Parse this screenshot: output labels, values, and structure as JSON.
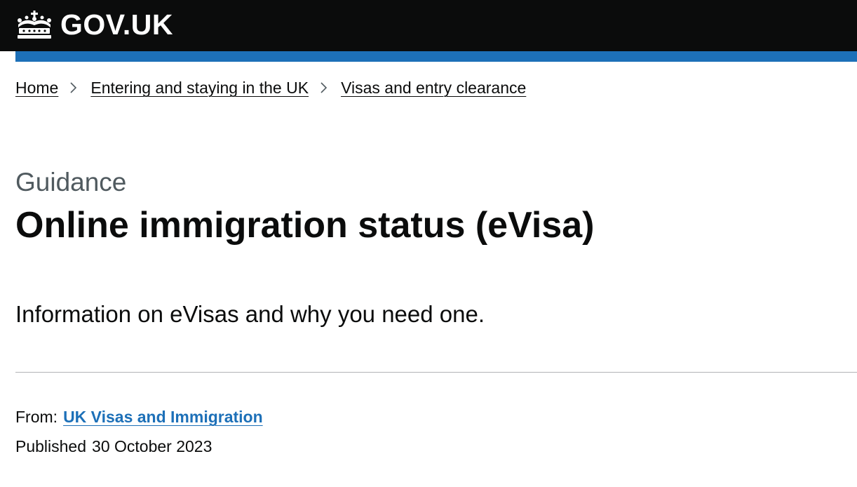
{
  "header": {
    "logo_text": "GOV.UK",
    "logo_icon": "crown-icon",
    "background_color": "#0b0c0c",
    "accent_bar_color": "#1d70b8"
  },
  "breadcrumb": {
    "items": [
      {
        "label": "Home"
      },
      {
        "label": "Entering and staying in the UK"
      },
      {
        "label": "Visas and entry clearance"
      }
    ],
    "separator_icon": "chevron-right-icon"
  },
  "page": {
    "caption": "Guidance",
    "title": "Online immigration status (eVisa)",
    "lead": "Information on eVisas and why you need one."
  },
  "metadata": {
    "from_label": "From:",
    "organisation": "UK Visas and Immigration",
    "link_color": "#1d70b8",
    "published_label": "Published",
    "published_date": "30 October 2023"
  }
}
